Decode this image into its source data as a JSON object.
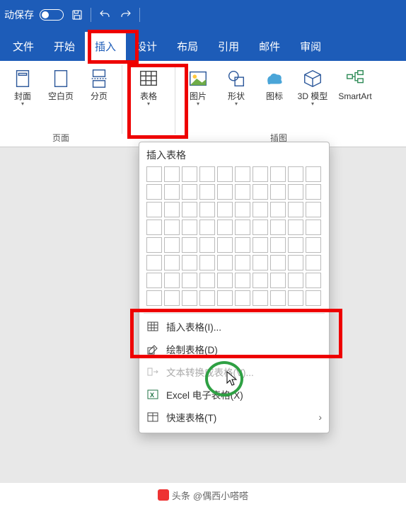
{
  "titlebar": {
    "autosave": "动保存"
  },
  "tabs": {
    "file": "文件",
    "home": "开始",
    "insert": "插入",
    "design": "设计",
    "layout": "布局",
    "references": "引用",
    "mail": "邮件",
    "review": "审阅"
  },
  "ribbon": {
    "pages": {
      "cover": "封面",
      "blank": "空白页",
      "break": "分页",
      "group": "页面"
    },
    "table": {
      "label": "表格"
    },
    "illus": {
      "picture": "图片",
      "shapes": "形状",
      "icons": "图标",
      "model3d": "3D 模型",
      "smartart": "SmartArt",
      "group": "插图"
    }
  },
  "menu": {
    "title": "插入表格",
    "insert_table": "插入表格(I)...",
    "draw_table": "绘制表格(D)",
    "convert_text": "文本转换成表格(V)...",
    "excel": "Excel 电子表格(X)",
    "quick": "快速表格(T)"
  },
  "footer": {
    "source": "头条",
    "author": "@偶西小嗒嗒"
  }
}
